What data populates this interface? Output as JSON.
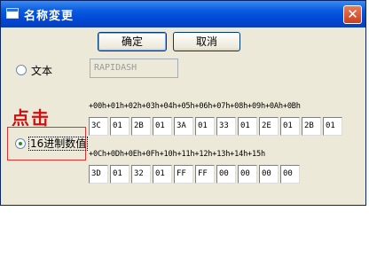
{
  "window": {
    "title": "名称変更",
    "close_glyph": "✕"
  },
  "buttons": {
    "ok_label": "确定",
    "cancel_label": "取消"
  },
  "text_option": {
    "label": "文本",
    "value": "RAPIDASH",
    "selected": false
  },
  "hex_option": {
    "label": "16进制数值",
    "selected": true
  },
  "annotation": {
    "text": "点击",
    "color": "#d01010"
  },
  "hex_grid": {
    "header_row1": "+00h+01h+02h+03h+04h+05h+06h+07h+08h+09h+0Ah+0Bh",
    "values_row1": [
      "3C",
      "01",
      "2B",
      "01",
      "3A",
      "01",
      "33",
      "01",
      "2E",
      "01",
      "2B",
      "01"
    ],
    "header_row2": "+0Ch+0Dh+0Eh+0Fh+10h+11h+12h+13h+14h+15h",
    "values_row2": [
      "3D",
      "01",
      "32",
      "01",
      "FF",
      "FF",
      "00",
      "00",
      "00",
      "00"
    ]
  }
}
